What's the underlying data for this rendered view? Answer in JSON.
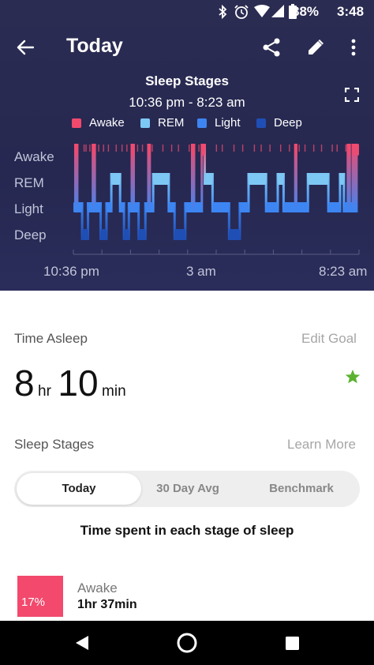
{
  "status_bar": {
    "battery": "88%",
    "time": "3:48"
  },
  "app_bar": {
    "title": "Today",
    "icons": [
      "back-arrow-icon",
      "share-icon",
      "edit-pencil-icon",
      "more-vert-icon"
    ]
  },
  "chart_header": {
    "title": "Sleep Stages",
    "time_range": "10:36 pm - 8:23 am"
  },
  "colors": {
    "awake": "#f2496d",
    "rem": "#7dc7f5",
    "light": "#3d85f2",
    "deep": "#1f4eb4",
    "star": "#5cb230"
  },
  "chart_data": {
    "type": "area",
    "title": "Sleep Stages",
    "subtitle": "10:36 pm - 8:23 am",
    "legend": [
      "Awake",
      "REM",
      "Light",
      "Deep"
    ],
    "stages": [
      "Awake",
      "REM",
      "Light",
      "Deep"
    ],
    "x_ticks": [
      "10:36 pm",
      "3 am",
      "8:23 am"
    ],
    "x_range": [
      "22:36",
      "08:23"
    ],
    "segments": [
      {
        "stage": "Light",
        "start": "22:36",
        "end": "22:40"
      },
      {
        "stage": "Awake",
        "start": "22:40",
        "end": "22:44"
      },
      {
        "stage": "Light",
        "start": "22:44",
        "end": "22:54"
      },
      {
        "stage": "Deep",
        "start": "22:54",
        "end": "23:06"
      },
      {
        "stage": "Light",
        "start": "23:06",
        "end": "23:16"
      },
      {
        "stage": "Awake",
        "start": "23:16",
        "end": "23:20"
      },
      {
        "stage": "Light",
        "start": "23:20",
        "end": "23:32"
      },
      {
        "stage": "Deep",
        "start": "23:32",
        "end": "23:44"
      },
      {
        "stage": "Light",
        "start": "23:44",
        "end": "23:54"
      },
      {
        "stage": "REM",
        "start": "23:54",
        "end": "00:12"
      },
      {
        "stage": "Light",
        "start": "00:12",
        "end": "00:20"
      },
      {
        "stage": "Deep",
        "start": "00:20",
        "end": "00:30"
      },
      {
        "stage": "Light",
        "start": "00:30",
        "end": "00:36"
      },
      {
        "stage": "Awake",
        "start": "00:36",
        "end": "00:40"
      },
      {
        "stage": "Light",
        "start": "00:40",
        "end": "00:50"
      },
      {
        "stage": "Deep",
        "start": "00:50",
        "end": "01:04"
      },
      {
        "stage": "Light",
        "start": "01:04",
        "end": "01:10"
      },
      {
        "stage": "Awake",
        "start": "01:10",
        "end": "01:13"
      },
      {
        "stage": "Light",
        "start": "01:13",
        "end": "01:20"
      },
      {
        "stage": "REM",
        "start": "01:20",
        "end": "01:52"
      },
      {
        "stage": "Light",
        "start": "01:52",
        "end": "02:04"
      },
      {
        "stage": "Deep",
        "start": "02:04",
        "end": "02:26"
      },
      {
        "stage": "Light",
        "start": "02:26",
        "end": "02:40"
      },
      {
        "stage": "Awake",
        "start": "02:40",
        "end": "02:44"
      },
      {
        "stage": "Light",
        "start": "02:44",
        "end": "03:00"
      },
      {
        "stage": "Awake",
        "start": "03:00",
        "end": "03:06"
      },
      {
        "stage": "REM",
        "start": "03:06",
        "end": "03:22"
      },
      {
        "stage": "Light",
        "start": "03:22",
        "end": "03:56"
      },
      {
        "stage": "Deep",
        "start": "03:56",
        "end": "04:18"
      },
      {
        "stage": "Light",
        "start": "04:18",
        "end": "04:36"
      },
      {
        "stage": "REM",
        "start": "04:36",
        "end": "05:12"
      },
      {
        "stage": "Light",
        "start": "05:12",
        "end": "05:36"
      },
      {
        "stage": "REM",
        "start": "05:36",
        "end": "05:48"
      },
      {
        "stage": "Light",
        "start": "05:48",
        "end": "06:12"
      },
      {
        "stage": "Awake",
        "start": "06:12",
        "end": "06:14"
      },
      {
        "stage": "Light",
        "start": "06:14",
        "end": "06:38"
      },
      {
        "stage": "REM",
        "start": "06:38",
        "end": "07:20"
      },
      {
        "stage": "Light",
        "start": "07:20",
        "end": "07:44"
      },
      {
        "stage": "REM",
        "start": "07:44",
        "end": "07:52"
      },
      {
        "stage": "Light",
        "start": "07:52",
        "end": "08:00"
      },
      {
        "stage": "Awake",
        "start": "08:00",
        "end": "08:04"
      },
      {
        "stage": "Light",
        "start": "08:04",
        "end": "08:10"
      },
      {
        "stage": "Awake",
        "start": "08:10",
        "end": "08:14"
      },
      {
        "stage": "Light",
        "start": "08:14",
        "end": "08:18"
      },
      {
        "stage": "Awake",
        "start": "08:18",
        "end": "08:23"
      }
    ],
    "brief_awakenings": [
      "22:58",
      "23:02",
      "23:10",
      "23:28",
      "23:38",
      "23:48",
      "00:04",
      "00:16",
      "00:26",
      "00:48",
      "00:58",
      "01:18",
      "01:40",
      "01:58",
      "02:12",
      "02:34",
      "02:54",
      "03:30",
      "03:42",
      "04:06",
      "04:24",
      "04:48",
      "05:02",
      "05:20",
      "05:42",
      "06:00",
      "06:20",
      "06:32",
      "06:50",
      "07:06",
      "07:28",
      "07:38",
      "07:56"
    ]
  },
  "time_asleep": {
    "label": "Time Asleep",
    "edit_goal": "Edit Goal",
    "hours": "8",
    "hr_unit": "hr",
    "minutes": "10",
    "min_unit": "min"
  },
  "sleep_stages_section": {
    "label": "Sleep Stages",
    "learn_more": "Learn More",
    "tabs": [
      "Today",
      "30 Day Avg",
      "Benchmark"
    ],
    "active_tab": "Today",
    "description": "Time spent in each stage of sleep"
  },
  "stage_rows": [
    {
      "name": "Awake",
      "percent": "17%",
      "duration": "1hr 37min"
    }
  ]
}
